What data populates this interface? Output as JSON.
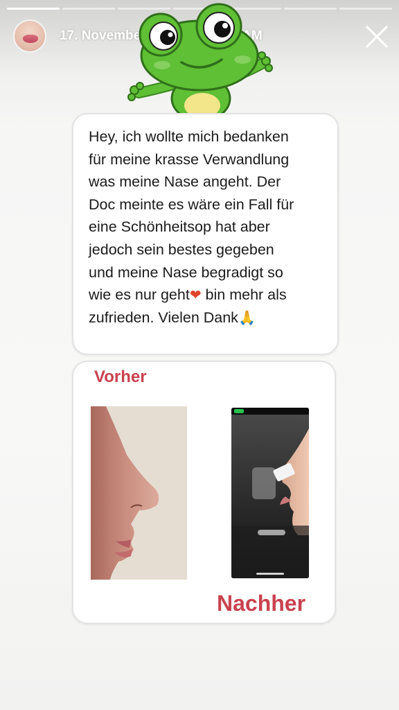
{
  "story": {
    "progress": [
      1,
      0,
      0,
      0,
      0,
      0,
      0
    ],
    "date": "17. November 2021",
    "time": "10:52 AM",
    "close_icon": "close-icon",
    "sticker": "frog-sticker"
  },
  "message": {
    "lines": [
      "Hey, ich wollte mich bedanken",
      "für meine krasse Verwandlung",
      "was meine Nase angeht. Der",
      "Doc meinte es wäre ein Fall für",
      "eine Schönheitsop hat aber",
      "jedoch sein bestes gegeben",
      "und meine Nase begradigt so",
      "wie es nur geht",
      " bin mehr als",
      "zufrieden. Vielen Dank"
    ],
    "heart_emoji": "❤",
    "hands_emoji": "🙏"
  },
  "comparison": {
    "before_label": "Vorher",
    "after_label": "Nachher"
  },
  "colors": {
    "label_red": "#c9424f",
    "text": "#1b1b1b",
    "card_bg": "#ffffff"
  }
}
